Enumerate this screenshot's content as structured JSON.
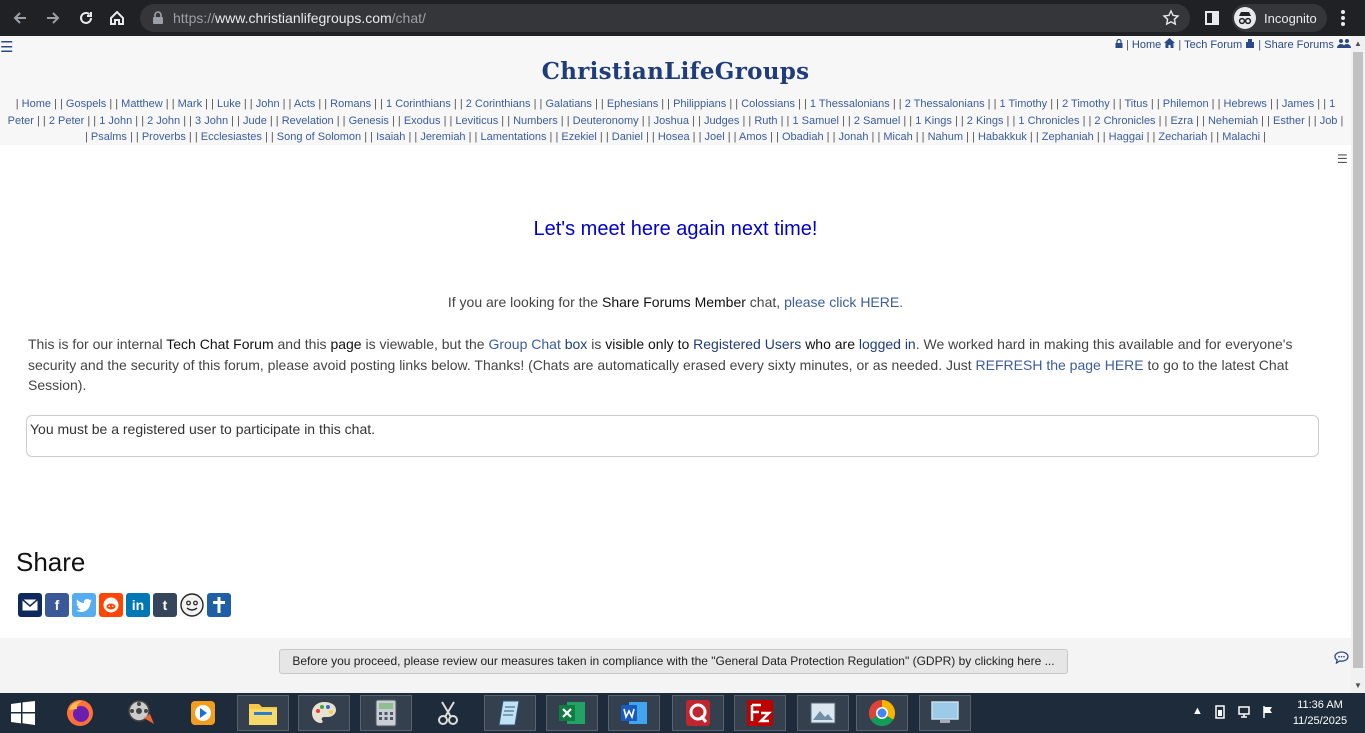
{
  "browser": {
    "url_prefix": "https://",
    "url_host": "www.christianlifegroups.com",
    "url_path": "/chat/",
    "incognito_label": "Incognito"
  },
  "header": {
    "menu_glyph": "☰",
    "top_links": [
      "Home",
      "Tech Forum",
      "Share Forums"
    ],
    "logo_text": "ChristianLifeGroups",
    "books": [
      "Home",
      "Gospels",
      "Matthew",
      "Mark",
      "Luke",
      "John",
      "Acts",
      "Romans",
      "1 Corinthians",
      "2 Corinthians",
      "Galatians",
      "Ephesians",
      "Philippians",
      "Colossians",
      "1 Thessalonians",
      "2 Thessalonians",
      "1 Timothy",
      "2 Timothy",
      "Titus",
      "Philemon",
      "Hebrews",
      "James",
      "1 Peter",
      "2 Peter",
      "1 John",
      "2 John",
      "3 John",
      "Jude",
      "Revelation",
      "Genesis",
      "Exodus",
      "Leviticus",
      "Numbers",
      "Deuteronomy",
      "Joshua",
      "Judges",
      "Ruth",
      "1 Samuel",
      "2 Samuel",
      "1 Kings",
      "2 Kings",
      "1 Chronicles",
      "2 Chronicles",
      "Ezra",
      "Nehemiah",
      "Esther",
      "Job",
      "Psalms",
      "Proverbs",
      "Ecclesiastes",
      "Song of Solomon",
      "Isaiah",
      "Jeremiah",
      "Lamentations",
      "Ezekiel",
      "Daniel",
      "Hosea",
      "Joel",
      "Amos",
      "Obadiah",
      "Jonah",
      "Micah",
      "Nahum",
      "Habakkuk",
      "Zephaniah",
      "Haggai",
      "Zechariah",
      "Malachi"
    ]
  },
  "main": {
    "headline": "Let's meet here again next time!",
    "p1": {
      "a": "If you are looking for the ",
      "b": "Share Forums Member",
      "c": " chat, ",
      "link": "please click HERE."
    },
    "p2": {
      "t1": "This is for our internal ",
      "b1": "Tech Chat Forum",
      "t2": " and this ",
      "b2": "page",
      "t3": " is viewable, but the ",
      "l1": "Group Chat",
      "t4": " ",
      "l2": "box",
      "t5": " is ",
      "b3": "visible only to",
      "t6": " ",
      "l3": "Registered Users",
      "t7": " ",
      "b4": "who are",
      "t8": " ",
      "l4": "logged in",
      "t9": ". We worked hard in making this available and for everyone's security and the security of this forum, please avoid posting links below.  Thanks! (Chats are automatically erased every sixty minutes, or as needed. Just ",
      "l5": "REFRESH the page HERE",
      "t10": " to go to the latest Chat Session)."
    },
    "notice": "You must be a registered user to participate in this chat.",
    "share_title": "Share",
    "gdpr_button": "Before you proceed, please review our measures taken in compliance with the \"General Data Protection Regulation\" (GDPR) by clicking here ..."
  },
  "share_colors": {
    "email": "#0e2a5c",
    "facebook": "#3b5998",
    "twitter": "#55acee",
    "reddit": "#ff4500",
    "linkedin": "#0077b5",
    "tumblr": "#35465c",
    "cross": "#1f5fa5"
  },
  "share_glyphs": {
    "facebook": "f",
    "linkedin": "in",
    "tumblr": "t"
  },
  "taskbar": {
    "icons": [
      "windows-start-icon",
      "firefox-icon",
      "media-center-icon",
      "media-player-icon",
      "file-explorer-icon",
      "paint-icon",
      "calculator-icon",
      "snipping-tool-icon",
      "notepad-icon",
      "excel-icon",
      "word-icon",
      "qt-app-icon",
      "filezilla-icon",
      "photo-viewer-icon",
      "chrome-icon",
      "remote-desktop-icon"
    ],
    "time": "11:36 AM",
    "date": "11/25/2025"
  }
}
